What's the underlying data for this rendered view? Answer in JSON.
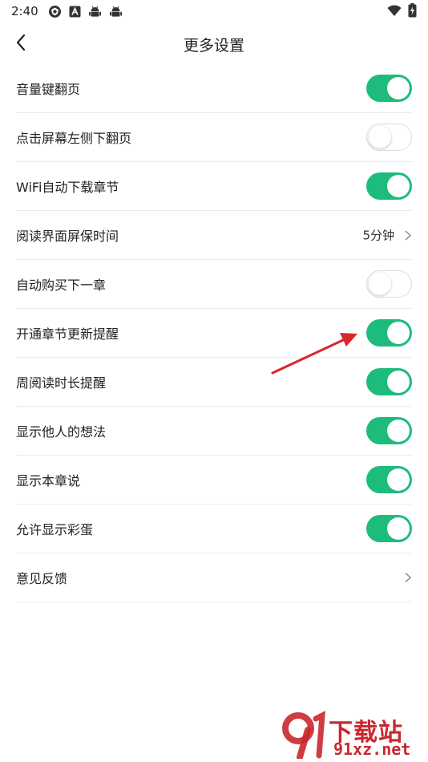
{
  "status_bar": {
    "time": "2:40",
    "icons": [
      "vpn-icon",
      "app-store-icon",
      "android-icon",
      "android-icon",
      "wifi-icon",
      "battery-charging-icon"
    ]
  },
  "header": {
    "back_icon": "chevron-left-icon",
    "title": "更多设置"
  },
  "colors": {
    "toggle_on": "#1dbc7c",
    "toggle_off_border": "#dcdcdc",
    "annotation_arrow": "#d9262c",
    "watermark": "#c9282e"
  },
  "settings": [
    {
      "label": "音量键翻页",
      "type": "toggle",
      "on": true
    },
    {
      "label": "点击屏幕左侧下翻页",
      "type": "toggle",
      "on": false
    },
    {
      "label": "WiFi自动下载章节",
      "type": "toggle",
      "on": true
    },
    {
      "label": "阅读界面屏保时间",
      "type": "value",
      "value": "5分钟"
    },
    {
      "label": "自动购买下一章",
      "type": "toggle",
      "on": false
    },
    {
      "label": "开通章节更新提醒",
      "type": "toggle",
      "on": true
    },
    {
      "label": "周阅读时长提醒",
      "type": "toggle",
      "on": true
    },
    {
      "label": "显示他人的想法",
      "type": "toggle",
      "on": true
    },
    {
      "label": "显示本章说",
      "type": "toggle",
      "on": true
    },
    {
      "label": "允许显示彩蛋",
      "type": "toggle",
      "on": true
    },
    {
      "label": "意见反馈",
      "type": "link"
    }
  ],
  "watermark": {
    "title": "下载站",
    "domain": "91xz.net"
  }
}
